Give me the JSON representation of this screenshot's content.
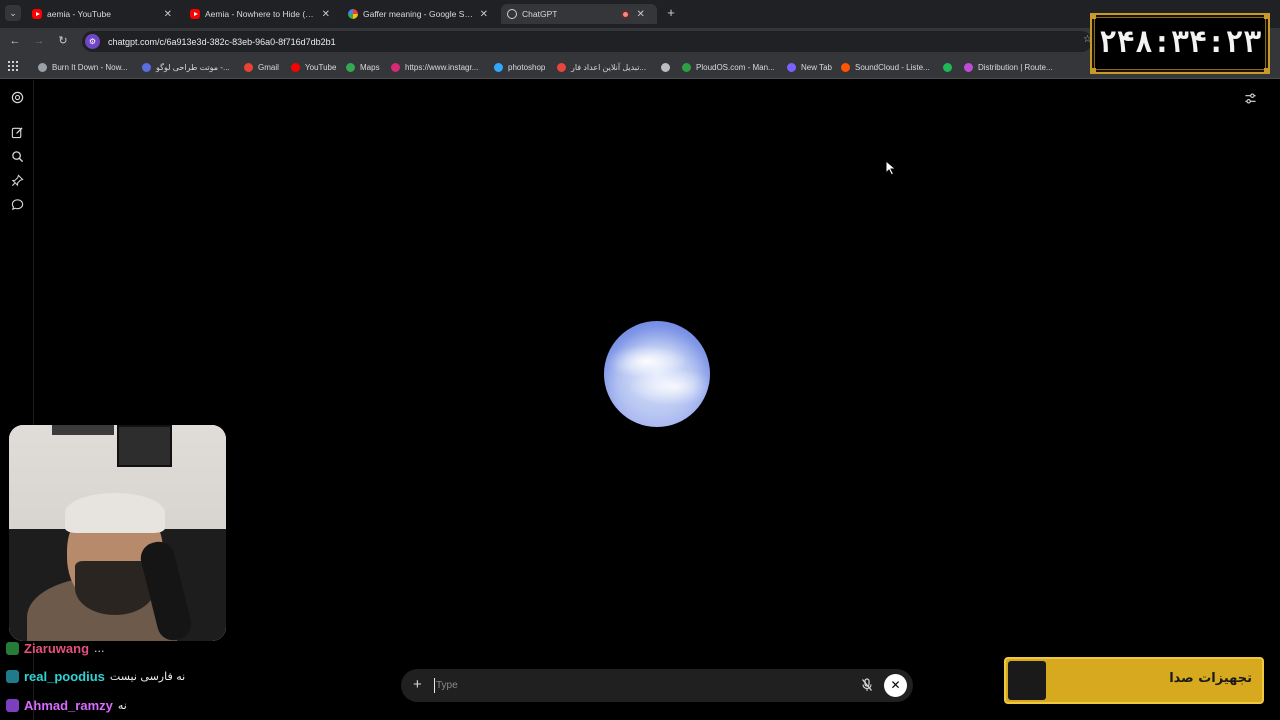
{
  "browser": {
    "tabs": [
      {
        "label": "aemia - YouTube",
        "favicon": "youtube-icon",
        "active": false
      },
      {
        "label": "Aemia - Nowhere to Hide (Offi",
        "favicon": "youtube-icon",
        "active": false
      },
      {
        "label": "Gaffer meaning - Google Searc",
        "favicon": "google-icon",
        "active": false
      },
      {
        "label": "ChatGPT",
        "favicon": "chatgpt-icon",
        "active": true
      }
    ],
    "url": "chatgpt.com/c/6a913e3d-382c-83eb-96a0-8f716d7db2b1",
    "bookmarks": [
      {
        "label": "Burn It Down - Now...",
        "favicon_color": "#9aa0a6"
      },
      {
        "label": "موتت طراحی لوگو -...",
        "favicon_color": "#5b6ee1"
      },
      {
        "label": "Gmail",
        "favicon_color": "#ea4335"
      },
      {
        "label": "YouTube",
        "favicon_color": "#ff0000"
      },
      {
        "label": "Maps",
        "favicon_color": "#34a853"
      },
      {
        "label": "https://www.instagr...",
        "favicon_color": "#d62976"
      },
      {
        "label": "photoshop",
        "favicon_color": "#31a8ff"
      },
      {
        "label": "تبدیل آنلاین اعداد فار...",
        "favicon_color": "#e8453c"
      },
      {
        "label": "",
        "favicon_color": "#bdbdbd"
      },
      {
        "label": "PloudOS.com - Man...",
        "favicon_color": "#2ea043"
      },
      {
        "label": "New Tab",
        "favicon_color": "#7b61ff"
      },
      {
        "label": "SoundCloud - Liste...",
        "favicon_color": "#ff5500"
      },
      {
        "label": "",
        "favicon_color": "#1db954"
      },
      {
        "label": "Distribution | Route...",
        "favicon_color": "#c04cd6"
      }
    ]
  },
  "chatgpt": {
    "composer": {
      "placeholder": "Type",
      "value": ""
    },
    "orb_colors": {
      "light": "#dfe7fb",
      "mid": "#b7c6f1",
      "dark": "#7f96e2"
    }
  },
  "overlay": {
    "clock": "۲۴۸:۳۴:۲۳",
    "chat": [
      {
        "user": "Ziaruwang",
        "message": "...",
        "user_color": "#ff5a8a",
        "badge_color": "#2b8a3e"
      },
      {
        "user": "real_poodius",
        "message": "نه فارسی نیست",
        "user_color": "#2ed3d6",
        "badge_color": "#1f7a8c"
      },
      {
        "user": "Ahmad_ramzy",
        "message": "نه",
        "user_color": "#d76cff",
        "badge_color": "#7b3fbf"
      }
    ],
    "sound_banner": "تجهیزات صدا",
    "accent": "#d6a91f"
  }
}
